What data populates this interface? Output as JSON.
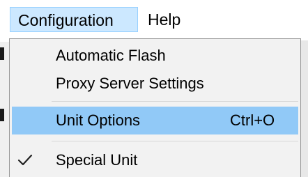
{
  "menubar": {
    "items": [
      {
        "label": "Configuration"
      },
      {
        "label": "Help"
      }
    ]
  },
  "dropdown": {
    "items": [
      {
        "label": "Automatic Flash",
        "shortcut": "",
        "checked": false,
        "highlighted": false
      },
      {
        "label": "Proxy Server Settings",
        "shortcut": "",
        "checked": false,
        "highlighted": false
      },
      {
        "label": "Unit Options",
        "shortcut": "Ctrl+O",
        "checked": false,
        "highlighted": true
      },
      {
        "label": "Special Unit",
        "shortcut": "",
        "checked": true,
        "highlighted": false
      }
    ]
  },
  "icons": {
    "check": "check-icon"
  },
  "colors": {
    "menubar_active_bg": "#cce8ff",
    "menubar_active_border": "#99d1ff",
    "dropdown_bg": "#f2f2f2",
    "highlight_bg": "#91c9f7",
    "separator": "#d7d7d7"
  }
}
